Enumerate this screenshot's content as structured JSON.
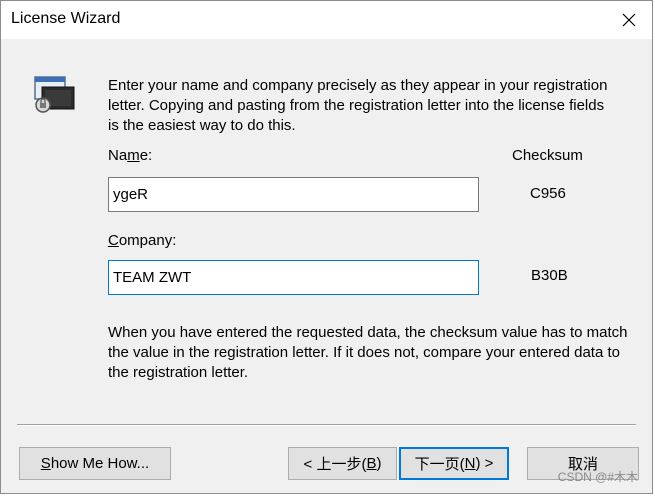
{
  "window": {
    "title": "License Wizard"
  },
  "intro_text": "Enter your name and company precisely as they appear in your registration letter.  Copying and pasting from the registration letter into the license fields is the easiest way to do this.",
  "name_field": {
    "label_pre": "Na",
    "label_accel": "m",
    "label_post": "e:",
    "value": "ygeR",
    "checksum": "C956"
  },
  "company_field": {
    "label_accel": "C",
    "label_post": "ompany:",
    "value": "TEAM ZWT",
    "checksum": "B30B"
  },
  "checksum_header": "Checksum",
  "outro_text": "When you have entered the requested data, the checksum value has to match the value in the registration letter.  If it does not, compare your entered data to the registration letter.",
  "buttons": {
    "show_me_how": {
      "accel": "S",
      "rest": "how Me How..."
    },
    "back": {
      "pre": "< 上一步(",
      "accel": "B",
      "post": ")"
    },
    "next": {
      "pre": "下一页(",
      "accel": "N",
      "post": ") >"
    },
    "cancel": "取消"
  },
  "watermark": "CSDN @#木木",
  "icons": {
    "close": "close-icon",
    "wizard": "license-key-icon"
  }
}
